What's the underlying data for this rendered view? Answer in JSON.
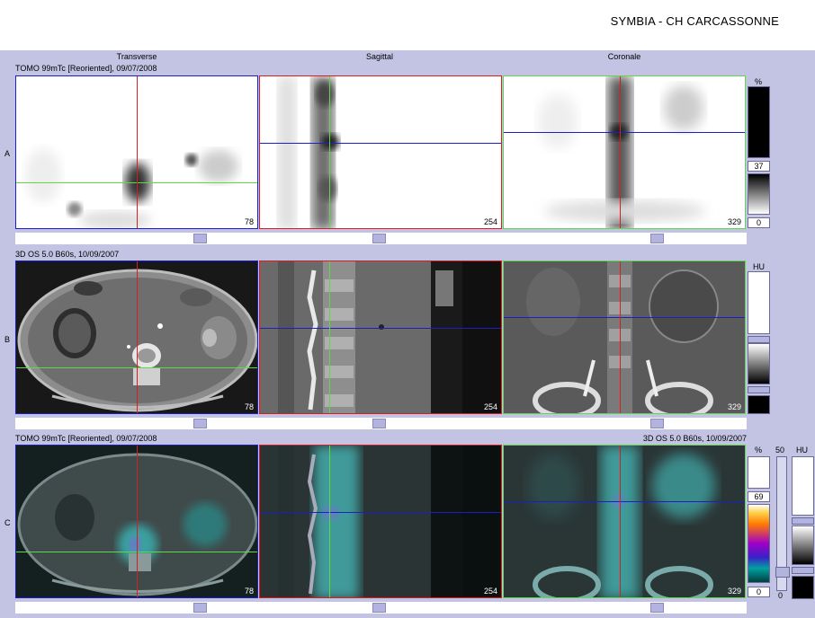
{
  "header": {
    "title": "SYMBIA - CH CARCASSONNE"
  },
  "columns": {
    "transverse": "Transverse",
    "sagittal": "Sagittal",
    "coronal": "Coronale"
  },
  "rows": {
    "a": {
      "label": "A",
      "series": "TOMO 99mTc [Reoriented], 09/07/2008",
      "unit": "%",
      "scale_max": "37",
      "scale_min": "0"
    },
    "b": {
      "label": "B",
      "series": "3D  OS  5.0  B60s, 10/09/2007",
      "unit": "HU"
    },
    "c": {
      "label": "C",
      "series_left": "TOMO 99mTc [Reoriented], 09/07/2008",
      "series_right": "3D  OS  5.0  B60s, 10/09/2007",
      "unit_pct": "%",
      "unit_hu": "HU",
      "fusion_pct": "50",
      "scale_max": "69",
      "scale_min": "0",
      "fusion_min": "0"
    }
  },
  "slices": {
    "transverse": "78",
    "sagittal": "254",
    "coronal": "329"
  },
  "colors": {
    "red": "#d81e1e",
    "green": "#5fd84a",
    "blue": "#1a20c8"
  }
}
